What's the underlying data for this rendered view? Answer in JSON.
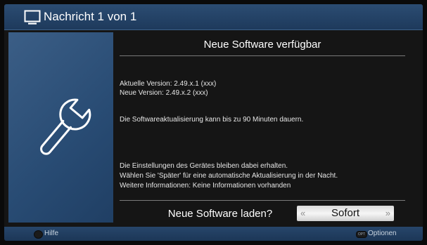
{
  "window": {
    "title": "Nachricht 1 von 1",
    "icon": "tv-icon"
  },
  "sidebar": {
    "icon": "wrench-icon"
  },
  "message": {
    "heading": "Neue Software verfügbar",
    "current_version": "Aktuelle Version: 2.49.x.1 (xxx)",
    "new_version": "Neue Version: 2.49.x.2 (xxx)",
    "duration_note": "Die Softwareaktualisierung kann bis zu 90 Minuten dauern.",
    "settings_note": "Die Einstellungen des Gerätes bleiben dabei erhalten.",
    "later_note": "Wählen Sie 'Später' für eine automatische Aktualisierung in der Nacht.",
    "info_note": "Weitere Informationen: Keine Informationen vorhanden"
  },
  "prompt": {
    "question": "Neue Software laden?",
    "selected_option": "Sofort",
    "arrow_left": "«",
    "arrow_right": "»"
  },
  "footer": {
    "help_label": "Hilfe",
    "options_label": "Optionen",
    "options_button_glyph": "OPT"
  },
  "colors": {
    "titlebar": "#2b4c72",
    "side_panel": "#2f5279",
    "background": "#151515",
    "selector": "#e8e8e8"
  }
}
